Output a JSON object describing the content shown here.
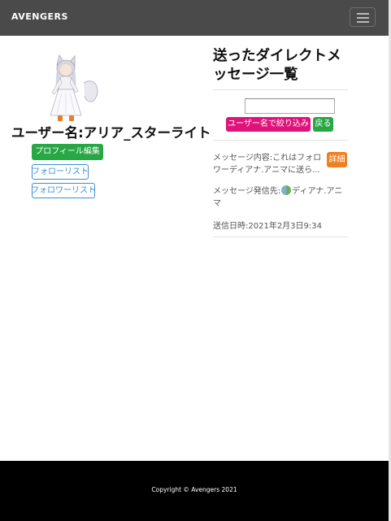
{
  "navbar": {
    "brand": "AVENGERS"
  },
  "profile": {
    "username": "ユーザー名:アリア_スターライト",
    "buttons": {
      "edit_profile": "プロフィール編集",
      "follow_list": "フォローリスト",
      "follower_list": "フォロワーリスト"
    }
  },
  "dm": {
    "title": "送ったダイレクトメッセージ一覧",
    "search": {
      "placeholder": ""
    },
    "filter_button": "ユーザー名で絞り込み",
    "back_button": "戻る",
    "messages": [
      {
        "content": "メッセージ内容:これはフォロワーディアナ.アニマに送ら...",
        "detail_button": "詳細",
        "sender_label": "メッセージ発信先:",
        "sender_name": "ディアナ.アニマ",
        "sent_at": "送信日時:2021年2月3日9:34"
      }
    ]
  },
  "footer": {
    "copyright": "Copyright © Avengers 2021"
  },
  "colors": {
    "navbar": "#4a4a4a",
    "success": "#28a745",
    "primary_outline": "#3b8ed6",
    "filter": "#e0137d",
    "detail": "#f07f1e",
    "footer": "#000000"
  },
  "icons": {
    "menu": "hamburger-icon",
    "avatar": "user-avatar-illustration",
    "sender": "sender-avatar-icon"
  }
}
